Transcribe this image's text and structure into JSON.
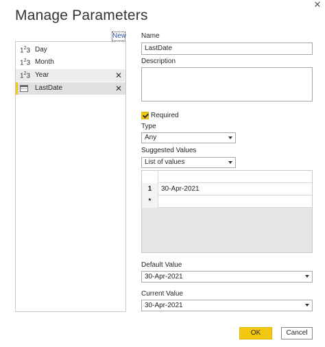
{
  "dialog": {
    "title": "Manage Parameters",
    "close_glyph": "✕"
  },
  "list": {
    "new_label": "New",
    "items": [
      {
        "icon": "number-type-icon",
        "label": "Day"
      },
      {
        "icon": "number-type-icon",
        "label": "Month"
      },
      {
        "icon": "number-type-icon",
        "label": "Year"
      },
      {
        "icon": "calendar-icon",
        "label": "LastDate"
      }
    ],
    "delete_glyph": "✕"
  },
  "form": {
    "name_label": "Name",
    "name_value": "LastDate",
    "description_label": "Description",
    "description_value": "",
    "required_label": "Required",
    "required_checked": true,
    "type_label": "Type",
    "type_value": "Any",
    "suggested_label": "Suggested Values",
    "suggested_value": "List of values",
    "values_grid": {
      "rows": [
        {
          "row_header": "1",
          "value": "30-Apr-2021"
        },
        {
          "row_header": "*",
          "value": ""
        }
      ]
    },
    "default_label": "Default Value",
    "default_value": "30-Apr-2021",
    "current_label": "Current Value",
    "current_value": "30-Apr-2021"
  },
  "buttons": {
    "ok": "OK",
    "cancel": "Cancel"
  },
  "colors": {
    "accent": "#f2c811",
    "selected_bg": "#e0e0e0"
  }
}
